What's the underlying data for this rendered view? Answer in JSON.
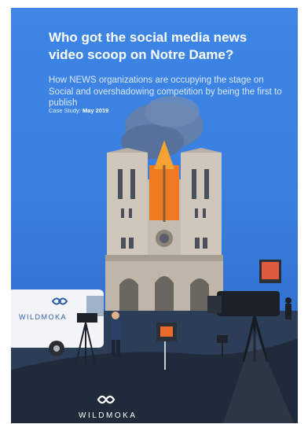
{
  "cover": {
    "title": "Who got the social media news video scoop on Notre Dame?",
    "subtitle": "How NEWS organizations are occupying the stage on Social and overshadowing competition by being the first to publish",
    "case_label": "Case Study:",
    "case_date": "May 2019"
  },
  "van": {
    "brand_text": "WILDMOKA"
  },
  "footer": {
    "brand_text": "WILDMOKA"
  },
  "colors": {
    "background": "#3a7fe0",
    "ground": "#1f2a3a",
    "fire": "#f07a22"
  }
}
